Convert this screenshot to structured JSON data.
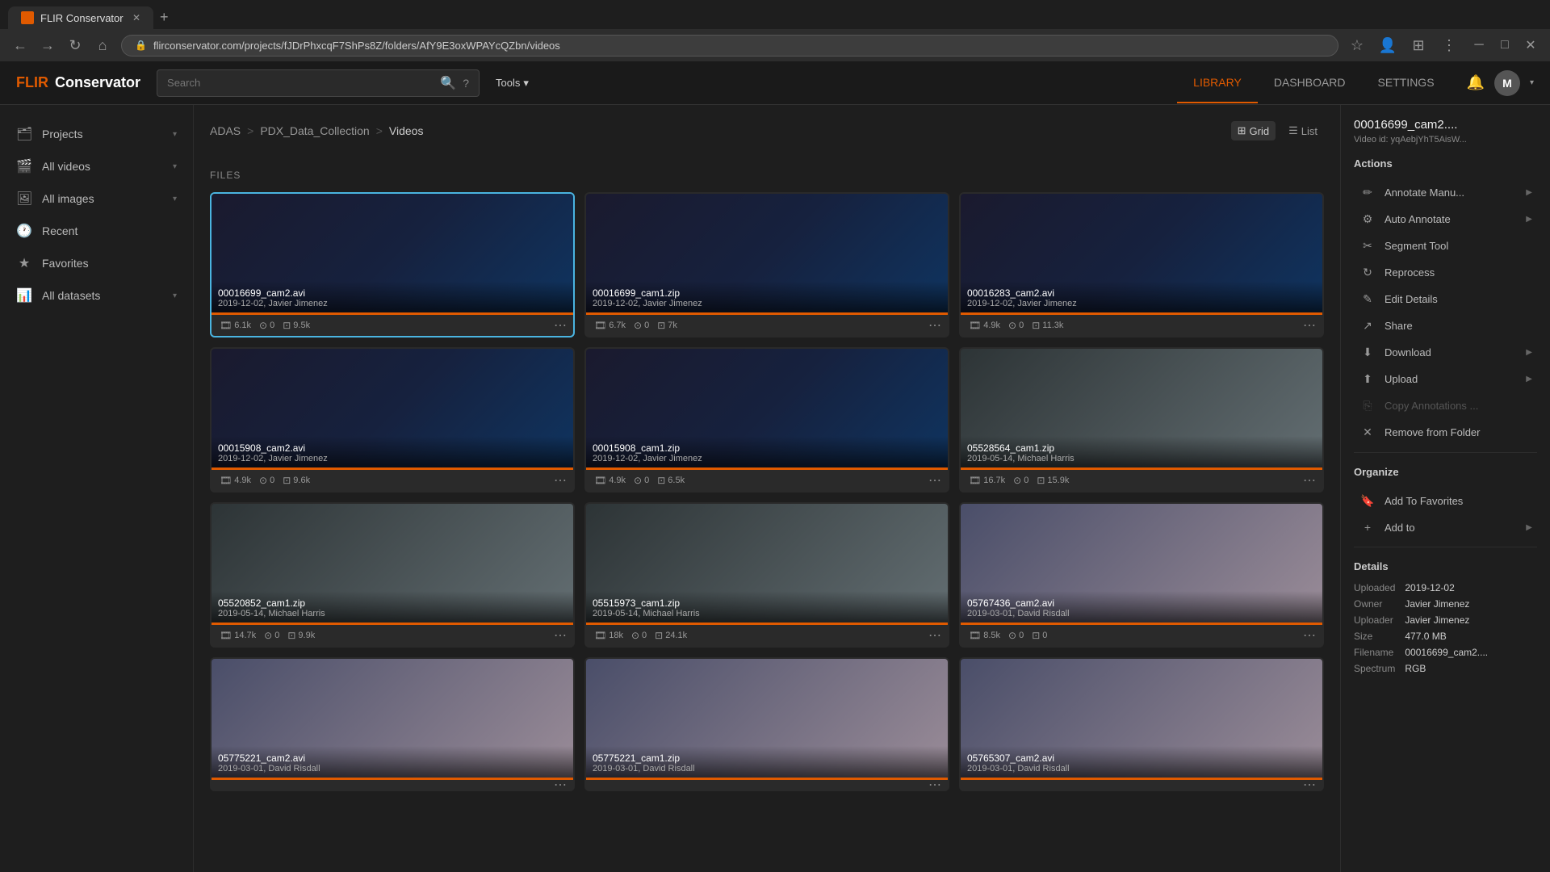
{
  "browser": {
    "tab_label": "FLIR Conservator",
    "url": "flirconservator.com/projects/fJDrPhxcqF7ShPs8Z/folders/AfY9E3oxWPAYcQZbn/videos",
    "new_tab_icon": "+"
  },
  "header": {
    "logo_brand": "FLIR",
    "logo_product": "Conservator",
    "search_placeholder": "Search",
    "tools_label": "Tools",
    "nav": {
      "library": "LIBRARY",
      "dashboard": "DASHBOARD",
      "settings": "SETTINGS"
    },
    "avatar_letter": "M"
  },
  "sidebar": {
    "items": [
      {
        "id": "projects",
        "label": "Projects",
        "icon": "🗂",
        "has_chevron": true
      },
      {
        "id": "all-videos",
        "label": "All videos",
        "icon": "🎬",
        "has_chevron": true
      },
      {
        "id": "all-images",
        "label": "All images",
        "icon": "🖼",
        "has_chevron": true
      },
      {
        "id": "recent",
        "label": "Recent",
        "icon": "🕐",
        "has_chevron": false
      },
      {
        "id": "favorites",
        "label": "Favorites",
        "icon": "★",
        "has_chevron": false
      },
      {
        "id": "all-datasets",
        "label": "All datasets",
        "icon": "📊",
        "has_chevron": true
      }
    ]
  },
  "breadcrumb": {
    "items": [
      "ADAS",
      "PDX_Data_Collection",
      "Videos"
    ],
    "separators": [
      ">",
      ">"
    ]
  },
  "view": {
    "grid_label": "Grid",
    "list_label": "List",
    "active": "grid",
    "files_section_label": "FILES"
  },
  "videos": [
    {
      "id": "v1",
      "title": "00016699_cam2.avi",
      "date": "2019-12-02, Javier Jimenez",
      "frames": "6.1k",
      "annotations": "0",
      "size": "9.5k",
      "selected": true,
      "thumb_type": "night"
    },
    {
      "id": "v2",
      "title": "00016699_cam1.zip",
      "date": "2019-12-02, Javier Jimenez",
      "frames": "6.7k",
      "annotations": "0",
      "size": "7k",
      "selected": false,
      "thumb_type": "night"
    },
    {
      "id": "v3",
      "title": "00016283_cam2.avi",
      "date": "2019-12-02, Javier Jimenez",
      "frames": "4.9k",
      "annotations": "0",
      "size": "11.3k",
      "selected": false,
      "thumb_type": "night"
    },
    {
      "id": "v4",
      "title": "00015908_cam2.avi",
      "date": "2019-12-02, Javier Jimenez",
      "frames": "4.9k",
      "annotations": "0",
      "size": "9.6k",
      "selected": false,
      "thumb_type": "night"
    },
    {
      "id": "v5",
      "title": "00015908_cam1.zip",
      "date": "2019-12-02, Javier Jimenez",
      "frames": "4.9k",
      "annotations": "0",
      "size": "6.5k",
      "selected": false,
      "thumb_type": "night"
    },
    {
      "id": "v6",
      "title": "05528564_cam1.zip",
      "date": "2019-05-14, Michael Harris",
      "frames": "16.7k",
      "annotations": "0",
      "size": "15.9k",
      "selected": false,
      "thumb_type": "day"
    },
    {
      "id": "v7",
      "title": "05520852_cam1.zip",
      "date": "2019-05-14, Michael Harris",
      "frames": "14.7k",
      "annotations": "0",
      "size": "9.9k",
      "selected": false,
      "thumb_type": "day"
    },
    {
      "id": "v8",
      "title": "05515973_cam1.zip",
      "date": "2019-05-14, Michael Harris",
      "frames": "18k",
      "annotations": "0",
      "size": "24.1k",
      "selected": false,
      "thumb_type": "day"
    },
    {
      "id": "v9",
      "title": "05767436_cam2.avi",
      "date": "2019-03-01, David Risdall",
      "frames": "8.5k",
      "annotations": "0",
      "size": "0",
      "selected": false,
      "thumb_type": "snow"
    },
    {
      "id": "v10",
      "title": "05775221_cam2.avi",
      "date": "2019-03-01, David Risdall",
      "frames": "",
      "annotations": "",
      "size": "",
      "selected": false,
      "thumb_type": "snow"
    },
    {
      "id": "v11",
      "title": "05775221_cam1.zip",
      "date": "2019-03-01, David Risdall",
      "frames": "",
      "annotations": "",
      "size": "",
      "selected": false,
      "thumb_type": "snow"
    },
    {
      "id": "v12",
      "title": "05765307_cam2.avi",
      "date": "2019-03-01, David Risdall",
      "frames": "",
      "annotations": "",
      "size": "",
      "selected": false,
      "thumb_type": "snow"
    }
  ],
  "right_panel": {
    "title": "00016699_cam2....",
    "subtitle": "Video id: yqAebjYhT5AisW...",
    "actions_label": "Actions",
    "actions": [
      {
        "id": "annotate",
        "label": "Annotate Manu...",
        "icon": "✏",
        "has_arrow": true,
        "disabled": false
      },
      {
        "id": "auto-annotate",
        "label": "Auto Annotate",
        "icon": "⚙",
        "has_arrow": true,
        "disabled": false
      },
      {
        "id": "segment-tool",
        "label": "Segment Tool",
        "icon": "✂",
        "has_arrow": false,
        "disabled": false
      },
      {
        "id": "reprocess",
        "label": "Reprocess",
        "icon": "↻",
        "has_arrow": false,
        "disabled": false
      },
      {
        "id": "edit-details",
        "label": "Edit Details",
        "icon": "✎",
        "has_arrow": false,
        "disabled": false
      },
      {
        "id": "share",
        "label": "Share",
        "icon": "↗",
        "has_arrow": false,
        "disabled": false
      },
      {
        "id": "download",
        "label": "Download",
        "icon": "⬇",
        "has_arrow": true,
        "disabled": false
      },
      {
        "id": "upload",
        "label": "Upload",
        "icon": "⬆",
        "has_arrow": true,
        "disabled": false
      },
      {
        "id": "copy-annotations",
        "label": "Copy Annotations ...",
        "icon": "⎘",
        "has_arrow": false,
        "disabled": true
      },
      {
        "id": "remove-from-folder",
        "label": "Remove from Folder",
        "icon": "✕",
        "has_arrow": false,
        "disabled": false
      }
    ],
    "organize_label": "Organize",
    "organize_actions": [
      {
        "id": "add-to-favorites",
        "label": "Add To Favorites",
        "icon": "🔖",
        "has_arrow": false,
        "disabled": false
      },
      {
        "id": "add-to",
        "label": "Add to",
        "icon": "+",
        "has_arrow": true,
        "disabled": false
      }
    ],
    "details_label": "Details",
    "details": [
      {
        "key": "Uploaded",
        "value": "2019-12-02"
      },
      {
        "key": "Owner",
        "value": "Javier Jimenez"
      },
      {
        "key": "Uploader",
        "value": "Javier Jimenez"
      },
      {
        "key": "Size",
        "value": "477.0 MB"
      },
      {
        "key": "Filename",
        "value": "00016699_cam2...."
      },
      {
        "key": "Spectrum",
        "value": "RGB"
      }
    ]
  }
}
